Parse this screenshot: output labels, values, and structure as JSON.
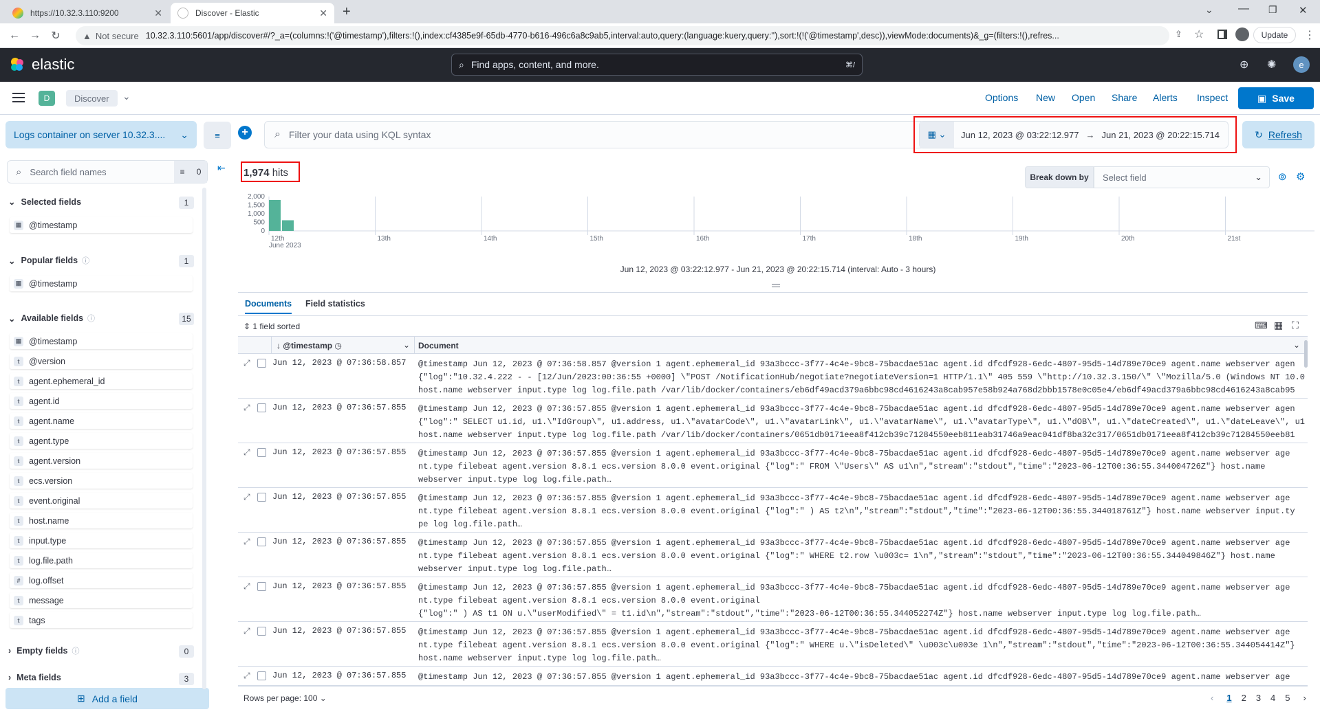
{
  "browser": {
    "tabs": [
      {
        "title": "https://10.32.3.110:9200"
      },
      {
        "title": "Discover - Elastic"
      }
    ],
    "not_secure": "Not secure",
    "url": "10.32.3.110:5601/app/discover#/?_a=(columns:!('@timestamp'),filters:!(),index:cf4385e9f-65db-4770-b616-496c6a8c9ab5,interval:auto,query:(language:kuery,query:''),sort:!(!('@timestamp',desc)),viewMode:documents)&_g=(filters:!(),refres...",
    "update_label": "Update"
  },
  "header": {
    "logo_text": "elastic",
    "search_placeholder": "Find apps, content, and more.",
    "shortcut": "⌘/",
    "avatar": "e"
  },
  "subheader": {
    "app_badge": "D",
    "breadcrumb": "Discover",
    "menu": [
      "Options",
      "New",
      "Open",
      "Share",
      "Alerts",
      "Inspect"
    ],
    "save_label": "Save"
  },
  "query": {
    "data_view": "Logs container on server 10.32.3....",
    "placeholder": "Filter your data using KQL syntax",
    "time_start": "Jun 12, 2023 @ 03:22:12.977",
    "time_end": "Jun 21, 2023 @ 20:22:15.714",
    "refresh_label": "Refresh"
  },
  "sidebar": {
    "search_placeholder": "Search field names",
    "filter_count": "0",
    "selected": {
      "label": "Selected fields",
      "count": "1",
      "fields": [
        {
          "name": "@timestamp",
          "type": "date"
        }
      ]
    },
    "popular": {
      "label": "Popular fields",
      "count": "1",
      "fields": [
        {
          "name": "@timestamp",
          "type": "date"
        }
      ]
    },
    "available": {
      "label": "Available fields",
      "count": "15",
      "fields": [
        {
          "name": "@timestamp",
          "type": "date"
        },
        {
          "name": "@version",
          "type": "t"
        },
        {
          "name": "agent.ephemeral_id",
          "type": "t"
        },
        {
          "name": "agent.id",
          "type": "t"
        },
        {
          "name": "agent.name",
          "type": "t"
        },
        {
          "name": "agent.type",
          "type": "t"
        },
        {
          "name": "agent.version",
          "type": "t"
        },
        {
          "name": "ecs.version",
          "type": "t"
        },
        {
          "name": "event.original",
          "type": "t"
        },
        {
          "name": "host.name",
          "type": "t"
        },
        {
          "name": "input.type",
          "type": "t"
        },
        {
          "name": "log.file.path",
          "type": "t"
        },
        {
          "name": "log.offset",
          "type": "#"
        },
        {
          "name": "message",
          "type": "t"
        },
        {
          "name": "tags",
          "type": "t"
        }
      ]
    },
    "empty": {
      "label": "Empty fields",
      "count": "0"
    },
    "meta": {
      "label": "Meta fields",
      "count": "3"
    },
    "add_field": "Add a field"
  },
  "results": {
    "hits_count": "1,974",
    "hits_label": "hits",
    "break_down_label": "Break down by",
    "break_down_placeholder": "Select field",
    "time_caption": "Jun 12, 2023 @ 03:22:12.977 - Jun 21, 2023 @ 20:22:15.714 (interval: Auto - 3 hours)",
    "tabs": [
      "Documents",
      "Field statistics"
    ],
    "sorted_label": "1 field sorted",
    "col_timestamp": "@timestamp",
    "col_document": "Document",
    "rows_per_page": "Rows per page: 100",
    "pages": [
      "1",
      "2",
      "3",
      "4",
      "5"
    ]
  },
  "chart_data": {
    "type": "bar",
    "x_tick_labels": [
      "12th",
      "13th",
      "14th",
      "15th",
      "16th",
      "17th",
      "18th",
      "19th",
      "20th",
      "21st"
    ],
    "x_sublabel": "June 2023",
    "y_tick_labels": [
      "2,000",
      "1,500",
      "1,000",
      "500",
      "0"
    ],
    "ylim": [
      0,
      2000
    ],
    "values": [
      1800,
      620
    ],
    "color": "#54b399"
  },
  "rows": [
    {
      "ts": "Jun 12, 2023 @ 07:36:58.857",
      "doc": "@timestamp Jun 12, 2023 @ 07:36:58.857 @version 1 agent.ephemeral_id 93a3bccc-3f77-4c4e-9bc8-75bacdae51ac agent.id dfcdf928-6edc-4807-95d5-14d789e70ce9 agent.name webserver agen\n{\"log\":\"10.32.4.222 - - [12/Jun/2023:00:36:55 +0000] \\\"POST /NotificationHub/negotiate?negotiateVersion=1 HTTP/1.1\\\" 405 559 \\\"http://10.32.3.150/\\\" \\\"Mozilla/5.0 (Windows NT 10.0\nhost.name webserver input.type log log.file.path /var/lib/docker/containers/eb6df49acd379a6bbc98cd4616243a8cab957e58b924a768d2bbb1578e0c05e4/eb6df49acd379a6bbc98cd4616243a8cab95"
    },
    {
      "ts": "Jun 12, 2023 @ 07:36:57.855",
      "doc": "@timestamp Jun 12, 2023 @ 07:36:57.855 @version 1 agent.ephemeral_id 93a3bccc-3f77-4c4e-9bc8-75bacdae51ac agent.id dfcdf928-6edc-4807-95d5-14d789e70ce9 agent.name webserver agen\n{\"log\":\" SELECT u1.id, u1.\\\"IdGroup\\\", u1.address, u1.\\\"avatarCode\\\", u1.\\\"avatarLink\\\", u1.\\\"avatarName\\\", u1.\\\"avatarType\\\", u1.\\\"dOB\\\", u1.\\\"dateCreated\\\", u1.\\\"dateLeave\\\", u1\nhost.name webserver input.type log log.file.path /var/lib/docker/containers/0651db0171eea8f412cb39c71284550eeb811eab31746a9eac041df8ba32c317/0651db0171eea8f412cb39c71284550eeb81"
    },
    {
      "ts": "Jun 12, 2023 @ 07:36:57.855",
      "doc": "@timestamp Jun 12, 2023 @ 07:36:57.855 @version 1 agent.ephemeral_id 93a3bccc-3f77-4c4e-9bc8-75bacdae51ac agent.id dfcdf928-6edc-4807-95d5-14d789e70ce9 agent.name webserver age\nnt.type filebeat agent.version 8.8.1 ecs.version 8.0.0 event.original {\"log\":\" FROM \\\"Users\\\" AS u1\\n\",\"stream\":\"stdout\",\"time\":\"2023-06-12T00:36:55.344004726Z\"} host.name\nwebserver input.type log log.file.path…"
    },
    {
      "ts": "Jun 12, 2023 @ 07:36:57.855",
      "doc": "@timestamp Jun 12, 2023 @ 07:36:57.855 @version 1 agent.ephemeral_id 93a3bccc-3f77-4c4e-9bc8-75bacdae51ac agent.id dfcdf928-6edc-4807-95d5-14d789e70ce9 agent.name webserver age\nnt.type filebeat agent.version 8.8.1 ecs.version 8.0.0 event.original {\"log\":\" ) AS t2\\n\",\"stream\":\"stdout\",\"time\":\"2023-06-12T00:36:55.344018761Z\"} host.name webserver input.ty\npe log log.file.path…"
    },
    {
      "ts": "Jun 12, 2023 @ 07:36:57.855",
      "doc": "@timestamp Jun 12, 2023 @ 07:36:57.855 @version 1 agent.ephemeral_id 93a3bccc-3f77-4c4e-9bc8-75bacdae51ac agent.id dfcdf928-6edc-4807-95d5-14d789e70ce9 agent.name webserver age\nnt.type filebeat agent.version 8.8.1 ecs.version 8.0.0 event.original {\"log\":\" WHERE t2.row \\u003c= 1\\n\",\"stream\":\"stdout\",\"time\":\"2023-06-12T00:36:55.344049846Z\"} host.name\nwebserver input.type log log.file.path…"
    },
    {
      "ts": "Jun 12, 2023 @ 07:36:57.855",
      "doc": "@timestamp Jun 12, 2023 @ 07:36:57.855 @version 1 agent.ephemeral_id 93a3bccc-3f77-4c4e-9bc8-75bacdae51ac agent.id dfcdf928-6edc-4807-95d5-14d789e70ce9 agent.name webserver age\nnt.type filebeat agent.version 8.8.1 ecs.version 8.0.0 event.original\n{\"log\":\" ) AS t1 ON u.\\\"userModified\\\" = t1.id\\n\",\"stream\":\"stdout\",\"time\":\"2023-06-12T00:36:55.344052274Z\"} host.name webserver input.type log log.file.path…"
    },
    {
      "ts": "Jun 12, 2023 @ 07:36:57.855",
      "doc": "@timestamp Jun 12, 2023 @ 07:36:57.855 @version 1 agent.ephemeral_id 93a3bccc-3f77-4c4e-9bc8-75bacdae51ac agent.id dfcdf928-6edc-4807-95d5-14d789e70ce9 agent.name webserver age\nnt.type filebeat agent.version 8.8.1 ecs.version 8.0.0 event.original {\"log\":\" WHERE u.\\\"isDeleted\\\" \\u003c\\u003e 1\\n\",\"stream\":\"stdout\",\"time\":\"2023-06-12T00:36:55.344054414Z\"}\nhost.name webserver input.type log log.file.path…"
    },
    {
      "ts": "Jun 12, 2023 @ 07:36:57.855",
      "doc": "@timestamp Jun 12, 2023 @ 07:36:57.855 @version 1 agent.ephemeral_id 93a3bccc-3f77-4c4e-9bc8-75bacdae51ac agent.id dfcdf928-6edc-4807-95d5-14d789e70ce9 agent.name webserver age"
    }
  ]
}
